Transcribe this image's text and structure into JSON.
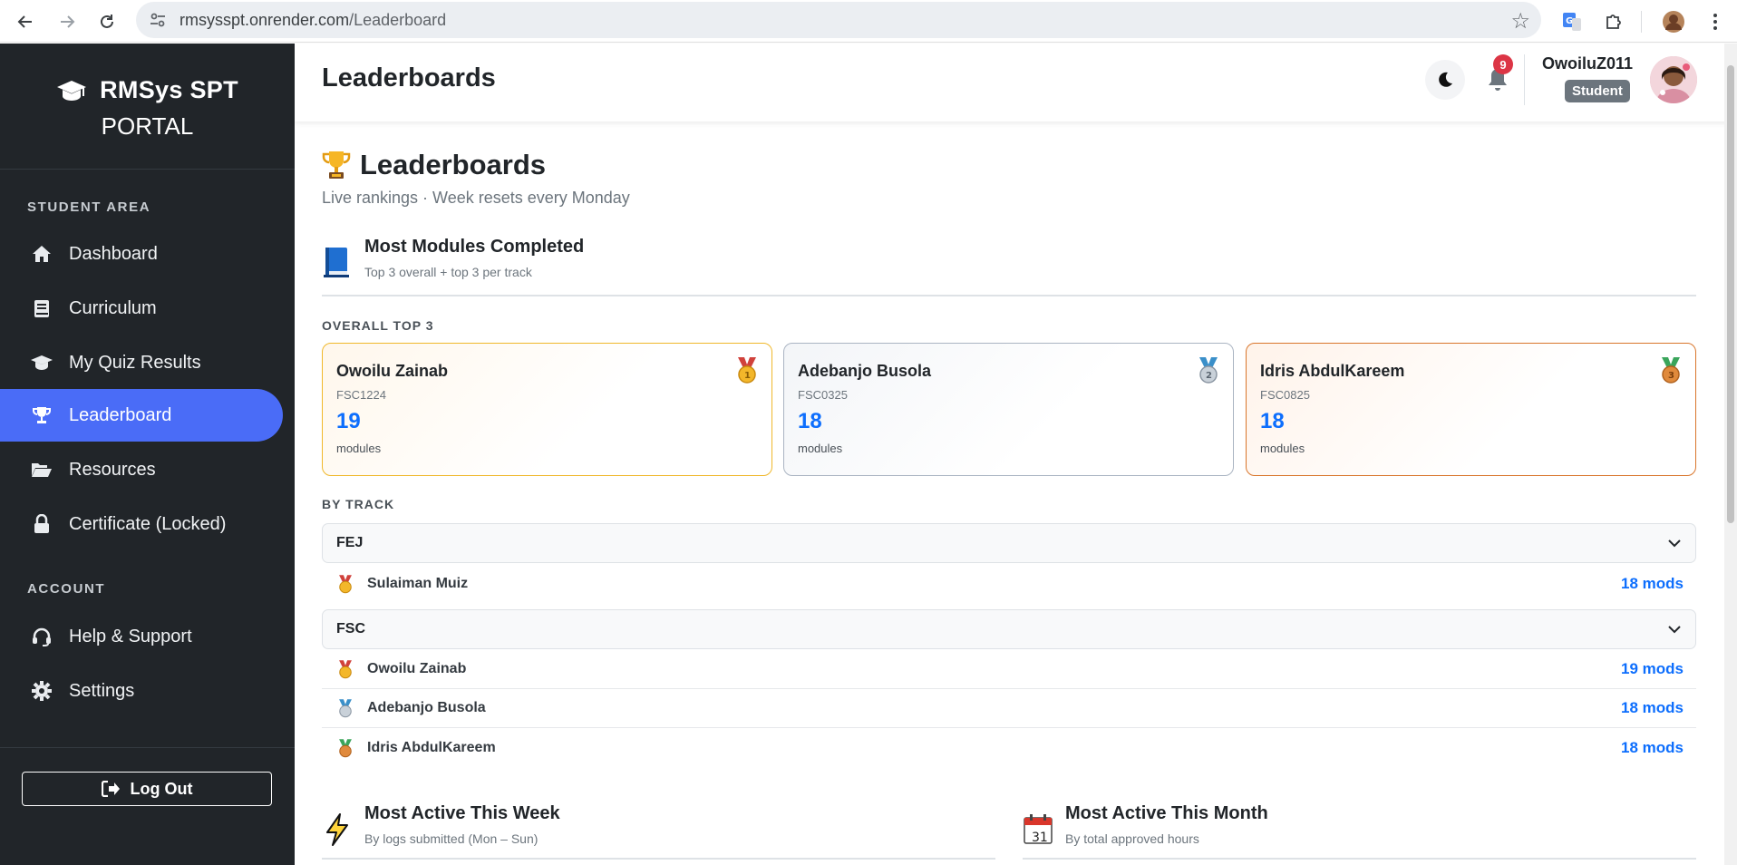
{
  "browser": {
    "url_host": "rmsysspt.onrender.com",
    "url_path": "/Leaderboard"
  },
  "sidebar": {
    "brand_line1": "RMSys SPT",
    "brand_line2": "PORTAL",
    "section_student": "STUDENT AREA",
    "section_account": "ACCOUNT",
    "items": [
      {
        "label": "Dashboard",
        "icon": "home-icon"
      },
      {
        "label": "Curriculum",
        "icon": "book-icon"
      },
      {
        "label": "My Quiz Results",
        "icon": "graduation-cap-icon"
      },
      {
        "label": "Leaderboard",
        "icon": "trophy-icon",
        "active": true
      },
      {
        "label": "Resources",
        "icon": "folder-open-icon"
      },
      {
        "label": "Certificate (Locked)",
        "icon": "lock-icon"
      }
    ],
    "account_items": [
      {
        "label": "Help & Support",
        "icon": "headset-icon"
      },
      {
        "label": "Settings",
        "icon": "gear-icon"
      }
    ],
    "logout_label": "Log Out"
  },
  "header": {
    "title": "Leaderboards",
    "notification_count": "9",
    "user_name": "OwoiluZ011",
    "role": "Student"
  },
  "main": {
    "title": "Leaderboards",
    "subtitle": "Live rankings · Week resets every Monday",
    "modules_section": {
      "title": "Most Modules Completed",
      "subtitle": "Top 3 overall + top 3 per track",
      "overall_label": "OVERALL TOP 3",
      "cards": [
        {
          "name": "Owoilu Zainab",
          "code": "FSC1224",
          "value": "19",
          "unit": "modules",
          "medal": "gold"
        },
        {
          "name": "Adebanjo Busola",
          "code": "FSC0325",
          "value": "18",
          "unit": "modules",
          "medal": "silver"
        },
        {
          "name": "Idris AbdulKareem",
          "code": "FSC0825",
          "value": "18",
          "unit": "modules",
          "medal": "bronze"
        }
      ],
      "by_track_label": "BY TRACK",
      "tracks": [
        {
          "name": "FEJ",
          "rows": [
            {
              "name": "Sulaiman Muiz",
              "value": "18 mods",
              "medal": "gold"
            }
          ]
        },
        {
          "name": "FSC",
          "rows": [
            {
              "name": "Owoilu Zainab",
              "value": "19 mods",
              "medal": "gold"
            },
            {
              "name": "Adebanjo Busola",
              "value": "18 mods",
              "medal": "silver"
            },
            {
              "name": "Idris AbdulKareem",
              "value": "18 mods",
              "medal": "bronze"
            }
          ]
        }
      ]
    },
    "week_section": {
      "title": "Most Active This Week",
      "subtitle": "By logs submitted (Mon – Sun)"
    },
    "month_section": {
      "title": "Most Active This Month",
      "subtitle": "By total approved hours",
      "calendar_day": "31"
    }
  },
  "colors": {
    "sidebar_bg": "#212529",
    "active_item": "#4a6cf7",
    "accent_number": "#0d6efd",
    "gold": "#f0b82b",
    "silver": "#aab4c2",
    "bronze": "#d9762c"
  }
}
